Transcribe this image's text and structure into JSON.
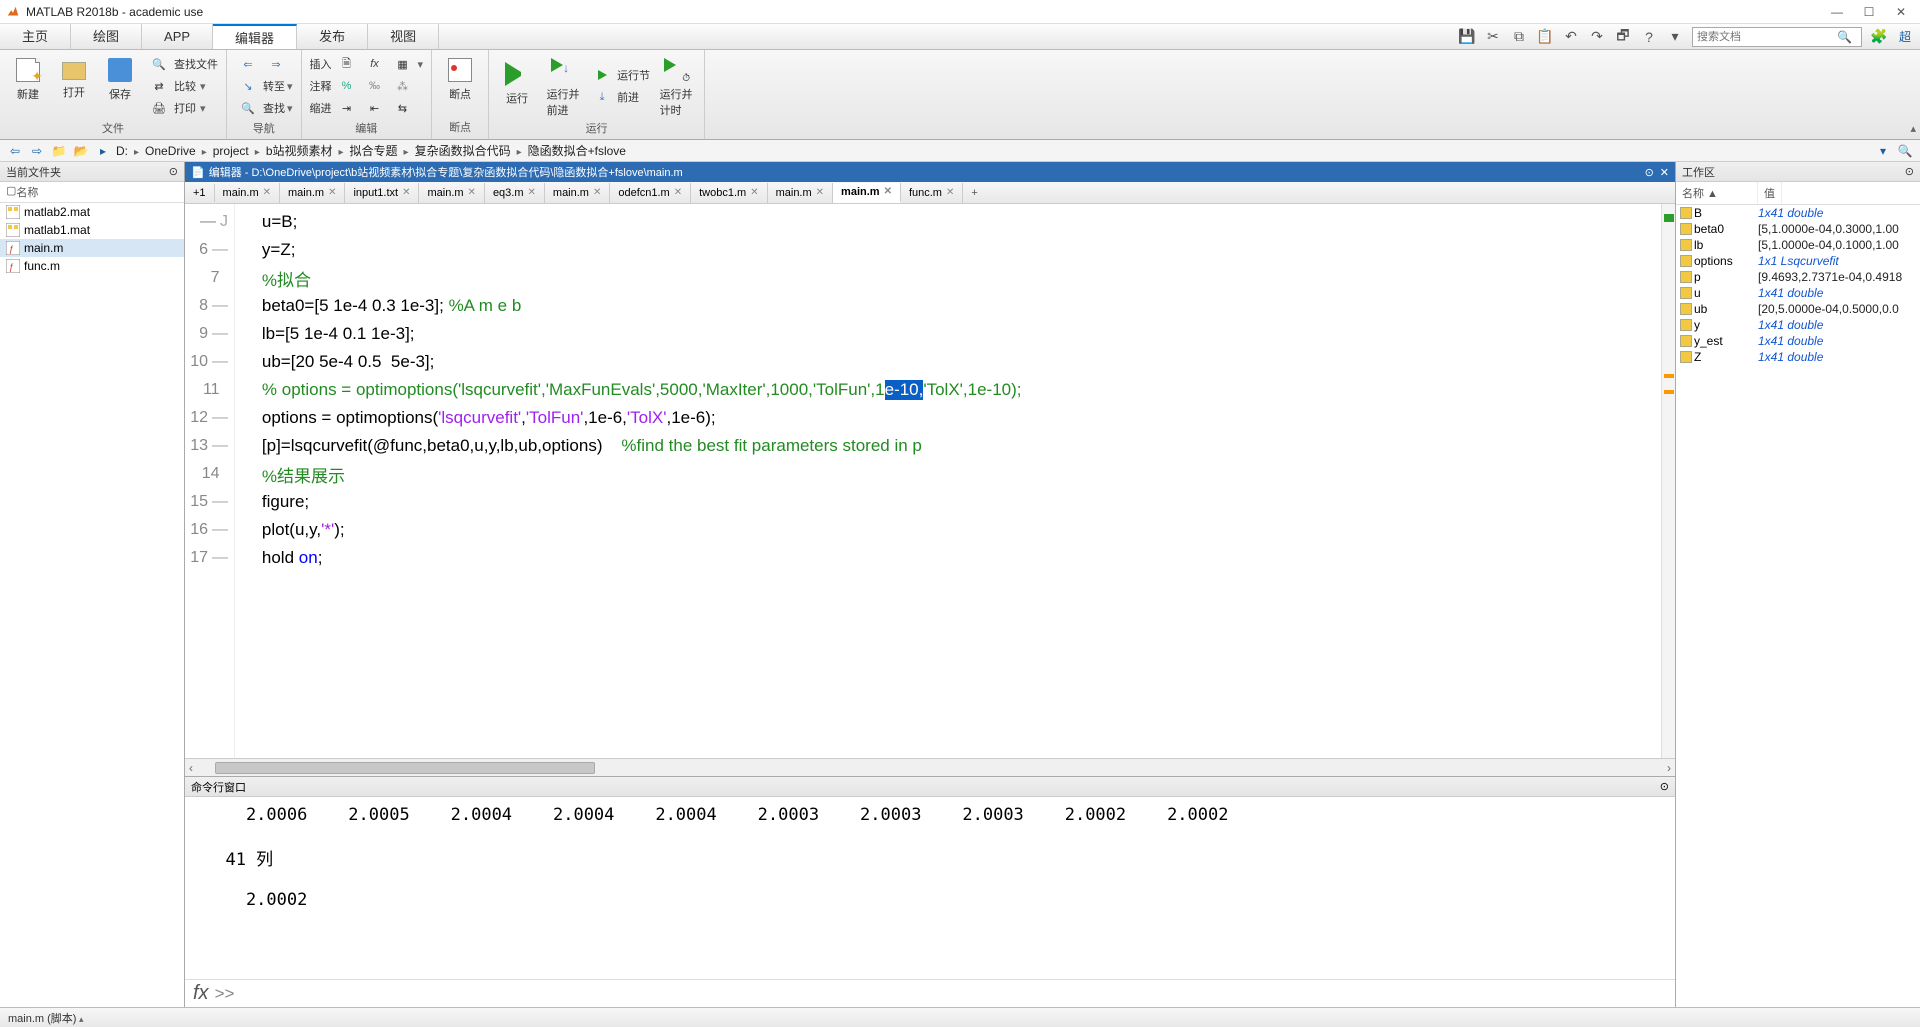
{
  "window": {
    "title": "MATLAB R2018b - academic use"
  },
  "menutabs": [
    "主页",
    "绘图",
    "APP",
    "编辑器",
    "发布",
    "视图"
  ],
  "menutabs_active": 3,
  "search_placeholder": "搜索文档",
  "ribbon_right_label": "超",
  "ribbon": {
    "file": {
      "new": "新建",
      "open": "打开",
      "save": "保存",
      "find_files": "查找文件",
      "compare": "比较",
      "print": "打印",
      "label": "文件"
    },
    "nav": {
      "goto": "转至",
      "find": "查找",
      "label": "导航"
    },
    "edit": {
      "insert": "插入",
      "comment": "注释",
      "indent": "缩进",
      "label": "编辑"
    },
    "bp": {
      "bp": "断点",
      "label": "断点"
    },
    "run": {
      "run": "运行",
      "run_advance": "运行并\n前进",
      "run_section": "运行节",
      "advance": "前进",
      "run_time": "运行并\n计时",
      "label": "运行"
    }
  },
  "path": [
    "D:",
    "OneDrive",
    "project",
    "b站视频素材",
    "拟合专题",
    "复杂函数拟合代码",
    "隐函数拟合+fslove"
  ],
  "current_folder": {
    "title": "当前文件夹",
    "name_hdr": "名称",
    "files": [
      {
        "name": "matlab2.mat",
        "icon": "mat"
      },
      {
        "name": "matlab1.mat",
        "icon": "mat"
      },
      {
        "name": "main.m",
        "icon": "m",
        "selected": true
      },
      {
        "name": "func.m",
        "icon": "m"
      }
    ]
  },
  "editor": {
    "title": "编辑器 - D:\\OneDrive\\project\\b站视频素材\\拟合专题\\复杂函数拟合代码\\隐函数拟合+fslove\\main.m",
    "tabs": [
      "main.m",
      "main.m",
      "input1.txt",
      "main.m",
      "eq3.m",
      "main.m",
      "odefcn1.m",
      "twobc1.m",
      "main.m",
      "main.m",
      "func.m"
    ],
    "tabs_active": 9,
    "first_tab": "+1",
    "lines": [
      {
        "n": "—",
        "g": "J",
        "segs": [
          {
            "t": "    u=B;",
            "c": ""
          }
        ]
      },
      {
        "n": "6",
        "g": "—",
        "segs": [
          {
            "t": "    y=Z;",
            "c": ""
          }
        ]
      },
      {
        "n": "7",
        "g": "",
        "segs": [
          {
            "t": "    ",
            "c": ""
          },
          {
            "t": "%拟合",
            "c": "comment"
          }
        ]
      },
      {
        "n": "8",
        "g": "—",
        "segs": [
          {
            "t": "    beta0=[5 1e-4 0.3 1e-3]; ",
            "c": ""
          },
          {
            "t": "%A m e b",
            "c": "comment"
          }
        ]
      },
      {
        "n": "9",
        "g": "—",
        "segs": [
          {
            "t": "    lb=[5 1e-4 0.1 1e-3];",
            "c": ""
          }
        ]
      },
      {
        "n": "10",
        "g": "—",
        "segs": [
          {
            "t": "    ub=[20 5e-4 0.5  5e-3];",
            "c": ""
          }
        ]
      },
      {
        "n": "11",
        "g": "",
        "segs": [
          {
            "t": "    ",
            "c": ""
          },
          {
            "t": "% options = optimoptions('lsqcurvefit','MaxFunEvals',5000,'MaxIter',1000,'TolFun',1",
            "c": "comment"
          },
          {
            "t": "e-10,",
            "c": "hl"
          },
          {
            "t": "'TolX',1e-10);",
            "c": "comment"
          }
        ]
      },
      {
        "n": "12",
        "g": "—",
        "segs": [
          {
            "t": "    options = optimoptions(",
            "c": ""
          },
          {
            "t": "'lsqcurvefit'",
            "c": "string"
          },
          {
            "t": ",",
            "c": ""
          },
          {
            "t": "'TolFun'",
            "c": "string"
          },
          {
            "t": ",1e-6,",
            "c": ""
          },
          {
            "t": "'TolX'",
            "c": "string"
          },
          {
            "t": ",1e-6);",
            "c": ""
          }
        ]
      },
      {
        "n": "13",
        "g": "—",
        "segs": [
          {
            "t": "    [p]=lsqcurvefit(@func,beta0,u,y,lb,ub,options)    ",
            "c": ""
          },
          {
            "t": "%find the best fit parameters stored in p",
            "c": "comment"
          }
        ]
      },
      {
        "n": "14",
        "g": "",
        "segs": [
          {
            "t": "    ",
            "c": ""
          },
          {
            "t": "%结果展示",
            "c": "comment"
          }
        ]
      },
      {
        "n": "15",
        "g": "—",
        "segs": [
          {
            "t": "    figure;",
            "c": ""
          }
        ]
      },
      {
        "n": "16",
        "g": "—",
        "segs": [
          {
            "t": "    plot(u,y,",
            "c": ""
          },
          {
            "t": "'*'",
            "c": "string"
          },
          {
            "t": ");",
            "c": ""
          }
        ]
      },
      {
        "n": "17",
        "g": "—",
        "segs": [
          {
            "t": "    hold ",
            "c": ""
          },
          {
            "t": "on",
            "c": "keyword"
          },
          {
            "t": ";",
            "c": ""
          }
        ]
      }
    ]
  },
  "command_window": {
    "title": "命令行窗口",
    "output": "    2.0006    2.0005    2.0004    2.0004    2.0004    2.0003    2.0003    2.0003    2.0002    2.0002\n\n  41 列\n\n    2.0002\n"
  },
  "workspace": {
    "title": "工作区",
    "hdr_name": "名称 ▲",
    "hdr_value": "值",
    "vars": [
      {
        "name": "B",
        "value": "1x41 double",
        "italic": true
      },
      {
        "name": "beta0",
        "value": "[5,1.0000e-04,0.3000,1.00",
        "italic": false
      },
      {
        "name": "lb",
        "value": "[5,1.0000e-04,0.1000,1.00",
        "italic": false
      },
      {
        "name": "options",
        "value": "1x1 Lsqcurvefit",
        "italic": true
      },
      {
        "name": "p",
        "value": "[9.4693,2.7371e-04,0.4918",
        "italic": false
      },
      {
        "name": "u",
        "value": "1x41 double",
        "italic": true
      },
      {
        "name": "ub",
        "value": "[20,5.0000e-04,0.5000,0.0",
        "italic": false
      },
      {
        "name": "y",
        "value": "1x41 double",
        "italic": true
      },
      {
        "name": "y_est",
        "value": "1x41 double",
        "italic": true
      },
      {
        "name": "Z",
        "value": "1x41 double",
        "italic": true
      }
    ]
  },
  "status": {
    "left": "main.m (脚本)"
  }
}
